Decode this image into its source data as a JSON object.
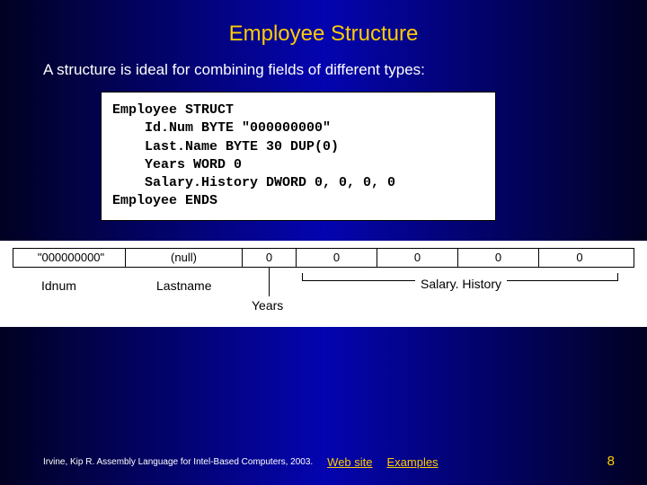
{
  "title": "Employee Structure",
  "intro": "A structure is ideal for combining fields of different types:",
  "code": "Employee STRUCT\n    Id.Num BYTE \"000000000\"\n    Last.Name BYTE 30 DUP(0)\n    Years WORD 0\n    Salary.History DWORD 0, 0, 0, 0\nEmployee ENDS",
  "diagram": {
    "cells": [
      "\"000000000\"",
      "(null)",
      "0",
      "0",
      "0",
      "0",
      "0"
    ],
    "idnum_label": "Idnum",
    "lastname_label": "Lastname",
    "years_label": "Years",
    "salary_label": "Salary. History"
  },
  "footer": {
    "credit": "Irvine, Kip R. Assembly Language for Intel-Based Computers, 2003.",
    "link1": "Web site",
    "link2": "Examples",
    "page": "8"
  }
}
